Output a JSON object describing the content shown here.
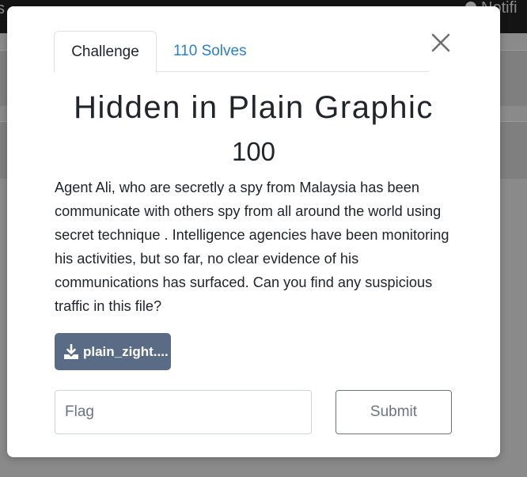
{
  "background": {
    "nav_left_text": "s",
    "notifications_label": "Notifi"
  },
  "modal": {
    "tabs": [
      {
        "label": "Challenge",
        "active": true
      },
      {
        "label": "110 Solves",
        "active": false
      }
    ],
    "title": "Hidden in Plain Graphic",
    "points": "100",
    "description": "Agent Ali, who are secretly a spy from Malaysia has been communicate with others spy from all around the world using secret technique . Intelligence agencies have been monitoring his activities, but so far, no clear evidence of his communications has surfaced. Can you find any suspicious traffic in this file?",
    "file_button": {
      "label": "plain_zight....",
      "icon": "download-icon"
    },
    "flag_input": {
      "placeholder": "Flag",
      "value": ""
    },
    "submit_label": "Submit",
    "close_icon": "close-icon"
  },
  "colors": {
    "overlay": "#8a8a8a",
    "topbar": "#141414",
    "link": "#2f7fbf",
    "file_button": "#5a6c85",
    "text": "#212529"
  }
}
